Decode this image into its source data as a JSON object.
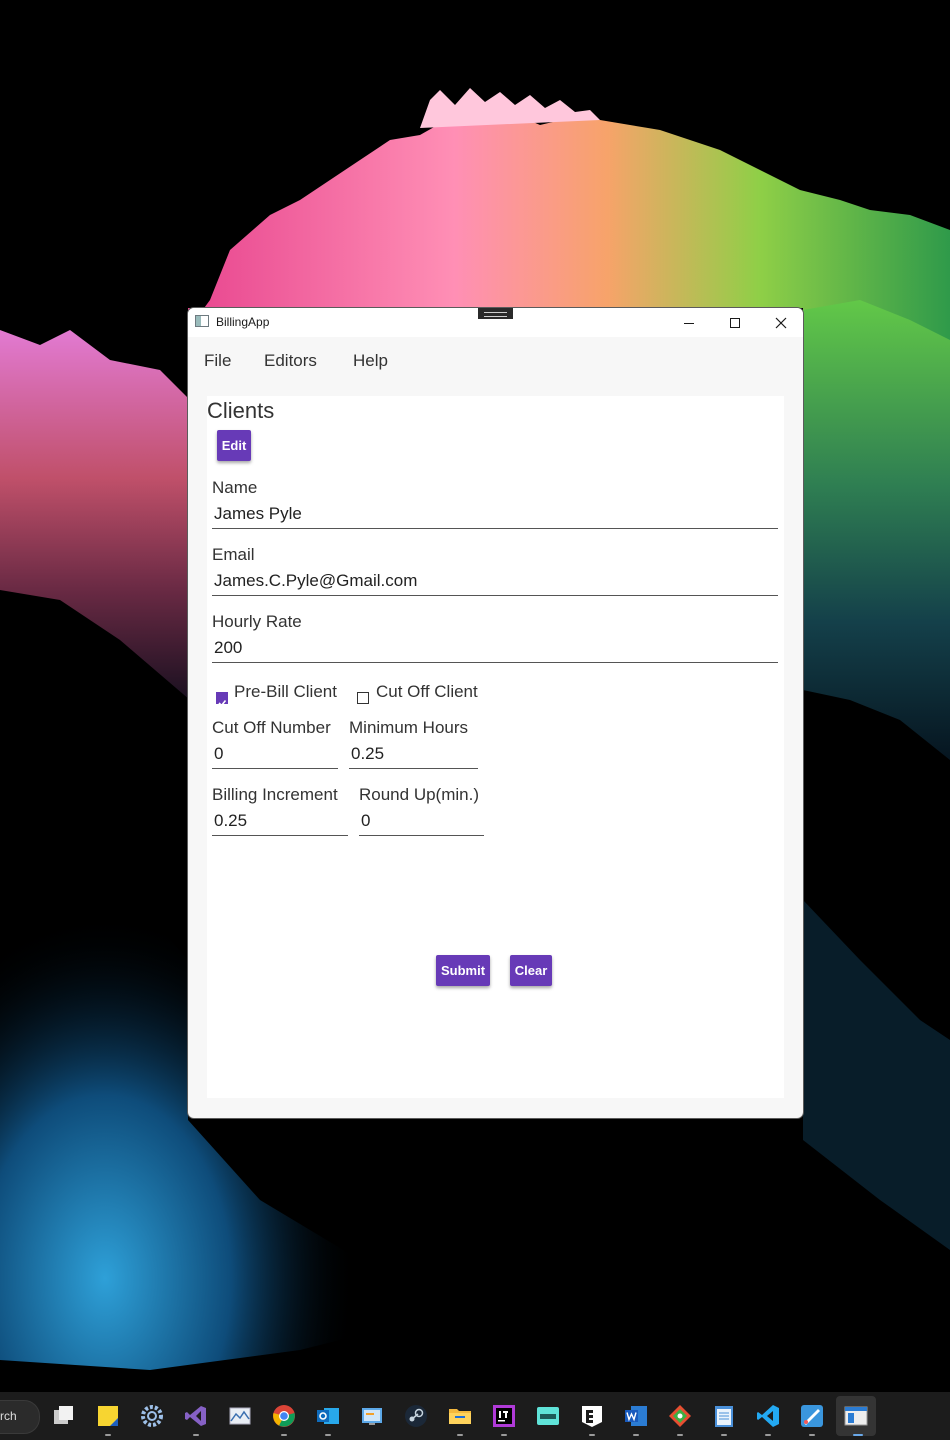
{
  "window": {
    "title": "BillingApp",
    "controls": [
      "minimize",
      "maximize",
      "close"
    ]
  },
  "menu": {
    "items": [
      "File",
      "Editors",
      "Help"
    ]
  },
  "clients": {
    "title": "Clients",
    "edit_label": "Edit",
    "name": {
      "label": "Name",
      "value": "James Pyle"
    },
    "email": {
      "label": "Email",
      "value": "James.C.Pyle@Gmail.com"
    },
    "hourly_rate": {
      "label": "Hourly Rate",
      "value": "200"
    },
    "pre_bill": {
      "label": "Pre-Bill Client",
      "checked": true
    },
    "cut_off": {
      "label": "Cut Off Client",
      "checked": false
    },
    "cut_off_number": {
      "label": "Cut Off Number",
      "value": "0"
    },
    "minimum_hours": {
      "label": "Minimum Hours",
      "value": "0.25"
    },
    "billing_increment": {
      "label": "Billing Increment",
      "value": "0.25"
    },
    "round_up": {
      "label": "Round Up(min.)",
      "value": "0"
    },
    "submit_label": "Submit",
    "clear_label": "Clear"
  },
  "colors": {
    "accent": "#673ab7",
    "taskbar": "#1c1c1c",
    "window_bg": "#f7f7f7"
  },
  "taskbar": {
    "search_text": "rch",
    "icons": [
      "task-view-icon",
      "sticky-notes-icon",
      "settings-icon",
      "visual-studio-icon",
      "photos-icon",
      "chrome-icon",
      "outlook-icon",
      "control-panel-icon",
      "steam-icon",
      "file-explorer-icon",
      "jetbrains-icon",
      "livesplit-icon",
      "epic-games-icon",
      "word-icon",
      "git-icon",
      "notepad-icon",
      "vscode-icon",
      "paint-icon",
      "billingapp-icon"
    ]
  }
}
